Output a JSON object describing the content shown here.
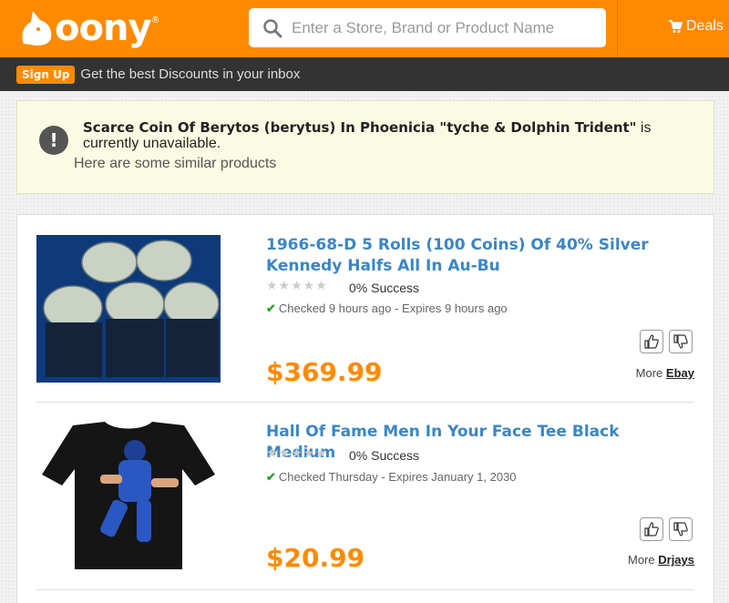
{
  "header": {
    "logo_text": "oony",
    "logo_reg": "®",
    "search_placeholder": "Enter a Store, Brand or Product Name",
    "deals_label": "Deals"
  },
  "signup": {
    "button_label": "Sign Up",
    "text": "Get the best Discounts in your inbox"
  },
  "notice": {
    "product_name": "Scarce Coin Of Berytos (berytus) In Phoenicia \"tyche & Dolphin Trident\"",
    "status_text": " is currently unavailable.",
    "subtext": "Here are some similar products"
  },
  "results": [
    {
      "title": "1966-68-D 5 Rolls (100 Coins) Of 40% Silver Kennedy Halfs All In Au-Bu",
      "stars": "★★★★★",
      "success": "0% Success",
      "checked": "Checked 9 hours ago - Expires 9 hours ago",
      "price": "$369.99",
      "more_label": "More",
      "store": "Ebay"
    },
    {
      "title": "Hall Of Fame Men In Your Face Tee Black Medium",
      "stars": "★★★★★",
      "success": "0% Success",
      "checked": "Checked Thursday - Expires January 1, 2030",
      "price": "$20.99",
      "more_label": "More",
      "store": "Drjays"
    }
  ],
  "colors": {
    "brand_orange": "#ff8a00",
    "link_blue": "#3b86c6",
    "dark_bar": "#333333",
    "notice_bg": "#fbfbe3"
  }
}
